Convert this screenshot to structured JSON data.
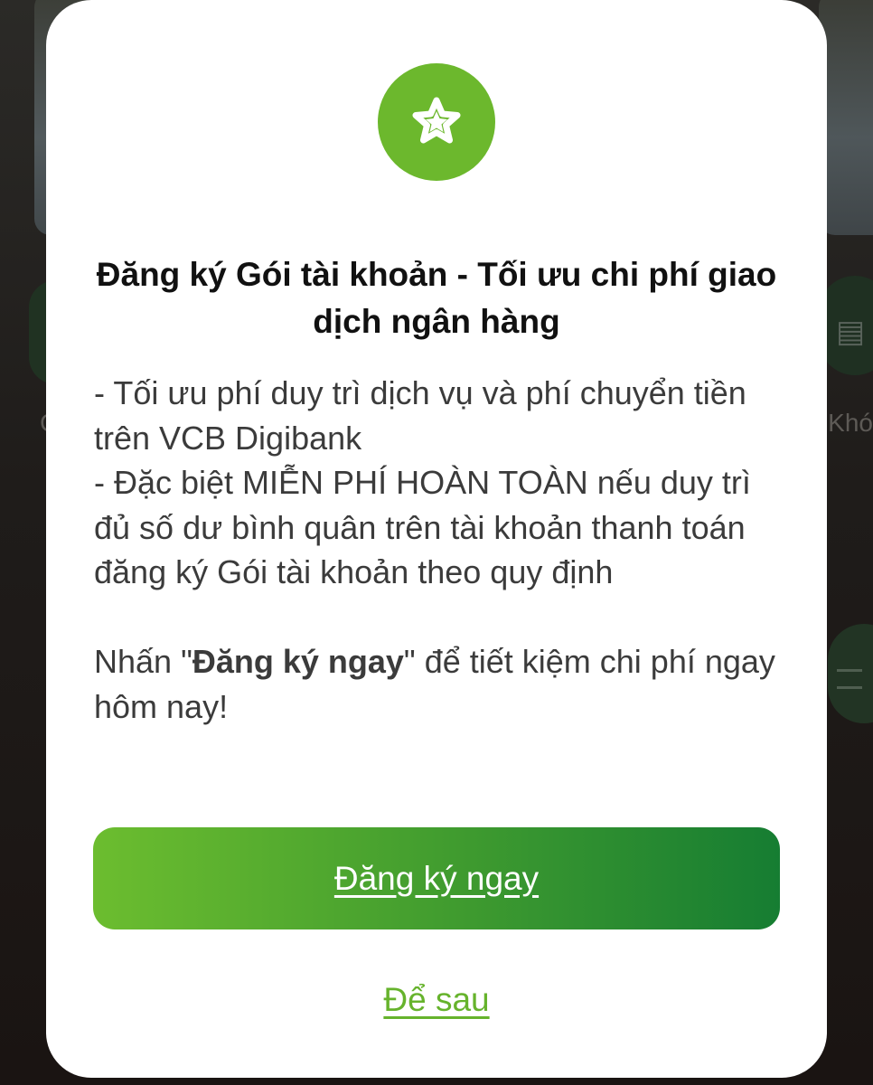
{
  "modal": {
    "icon": "star-badge-icon",
    "title": "Đăng ký Gói tài khoản - Tối ưu chi phí giao dịch ngân hàng",
    "desc_line1": "- Tối ưu phí duy trì dịch vụ và phí chuyển tiền trên VCB Digibank",
    "desc_line2": "- Đặc biệt MIỄN PHÍ HOÀN TOÀN nếu duy trì đủ số dư bình quân trên tài khoản thanh toán đăng ký Gói tài khoản theo quy định",
    "cta_prefix": "Nhấn \"",
    "cta_bold": "Đăng ký ngay",
    "cta_suffix": "\" để tiết kiệm chi phí ngay hôm nay!",
    "primary_button": "Đăng ký ngay",
    "later_link": "Để sau"
  },
  "background": {
    "left_label": "C",
    "right_label": "Khó",
    "right_icon": "card-icon"
  },
  "colors": {
    "accent_green": "#6cb82d",
    "button_gradient_start": "#6cbd2f",
    "button_gradient_end": "#167d32",
    "link_green": "#66b32c"
  }
}
